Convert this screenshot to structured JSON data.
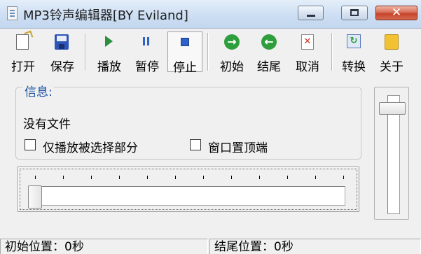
{
  "window": {
    "title": "MP3铃声编辑器[BY Eviland]",
    "controls": {
      "close": "✕"
    }
  },
  "toolbar": {
    "buttons": [
      {
        "label": "打开",
        "icon": "open-file-icon"
      },
      {
        "label": "保存",
        "icon": "save-icon"
      },
      {
        "label": "播放",
        "icon": "play-icon"
      },
      {
        "label": "暂停",
        "icon": "pause-icon"
      },
      {
        "label": "停止",
        "icon": "stop-icon"
      },
      {
        "label": "初始",
        "icon": "start-arrow-icon",
        "glyph": "→"
      },
      {
        "label": "结尾",
        "icon": "end-arrow-icon",
        "glyph": "←"
      },
      {
        "label": "取消",
        "icon": "cancel-icon",
        "glyph": "✕"
      },
      {
        "label": "转换",
        "icon": "convert-icon",
        "glyph": "↻"
      },
      {
        "label": "关于",
        "icon": "about-icon"
      }
    ]
  },
  "info": {
    "legend": "信息:",
    "file_status": "没有文件",
    "checkbox_play_selection": {
      "label": "仅播放被选择部分",
      "checked": false
    },
    "checkbox_topmost": {
      "label": "窗口置顶端",
      "checked": false
    }
  },
  "position_slider": {
    "value": 0
  },
  "volume_slider": {
    "value": 1.0
  },
  "status": {
    "start_position": "初始位置：0秒",
    "end_position": "结尾位置：0秒"
  },
  "colors": {
    "titlebar": "#cfe0f4",
    "close_button": "#c7432b",
    "legend_text": "#1a4fa0",
    "play_icon": "#2a8f3e",
    "pause_stop_icon": "#2d62c9",
    "nav_icons": "#2f9e3c"
  }
}
